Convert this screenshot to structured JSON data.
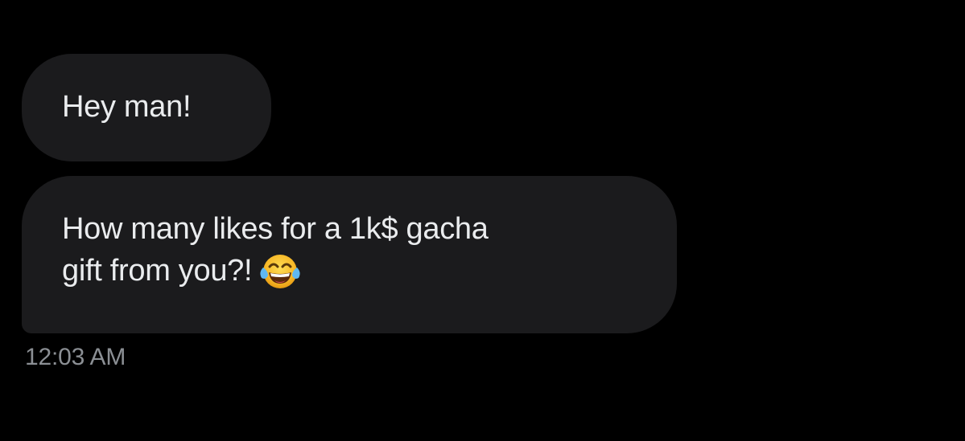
{
  "messages": [
    {
      "lines": [
        "Hey man!"
      ]
    },
    {
      "lines": [
        "How many likes for a 1k$ gacha",
        "gift from you?!"
      ],
      "emoji": "face-with-tears-of-joy-icon"
    }
  ],
  "timestamp": "12:03 AM",
  "colors": {
    "background": "#000000",
    "bubble": "#1b1b1d",
    "text": "#eaecee",
    "timestamp": "#8b8f94"
  }
}
